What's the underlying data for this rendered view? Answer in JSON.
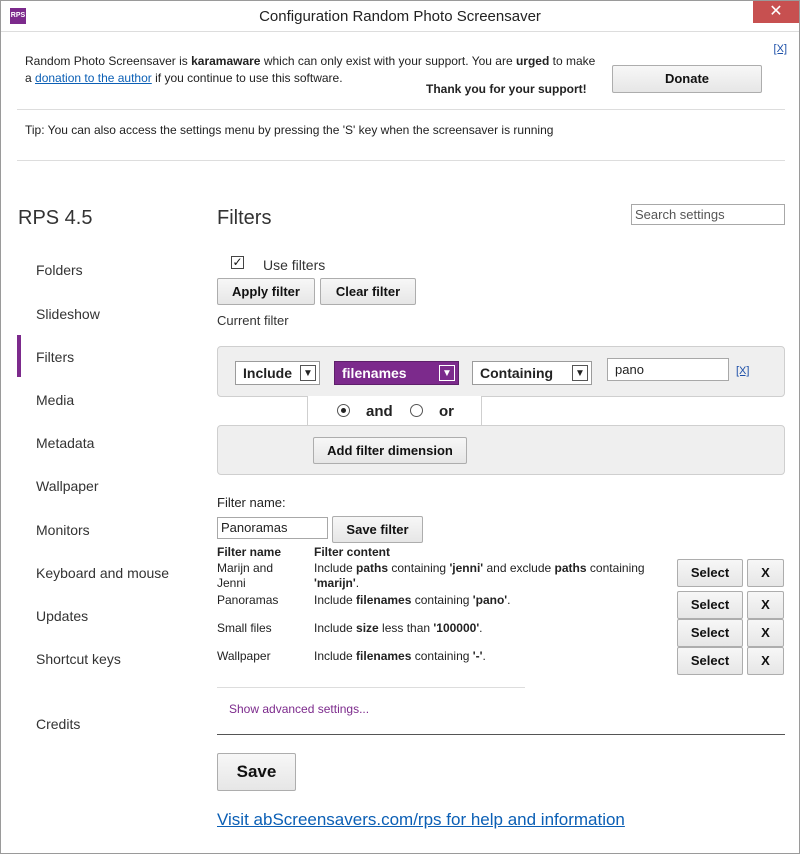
{
  "window": {
    "icon_text": "RPS",
    "title": "Configuration Random Photo Screensaver",
    "close_label": "✕"
  },
  "banner": {
    "line1_prefix": "Random Photo Screensaver is ",
    "line1_bold1": "karamaware",
    "line1_mid": " which can only exist with your support. You are ",
    "line1_bold2": "urged",
    "line1_suffix": " to make",
    "line2_prefix": "a ",
    "donation_link": "donation to the author",
    "line2_suffix": " if you continue to use this software.",
    "thanks": "Thank you for your support!",
    "donate_label": "Donate",
    "dismiss_label": "[X]"
  },
  "tip": "Tip: You can also access the settings menu by pressing the 'S' key when the screensaver is running",
  "sidebar": {
    "brand": "RPS 4.5",
    "items": [
      {
        "label": "Folders"
      },
      {
        "label": "Slideshow"
      },
      {
        "label": "Filters"
      },
      {
        "label": "Media"
      },
      {
        "label": "Metadata"
      },
      {
        "label": "Wallpaper"
      },
      {
        "label": "Monitors"
      },
      {
        "label": "Keyboard and mouse"
      },
      {
        "label": "Updates"
      },
      {
        "label": "Shortcut keys"
      },
      {
        "label": "Credits"
      }
    ],
    "active": "Filters"
  },
  "main": {
    "title": "Filters",
    "search_placeholder": "Search settings",
    "use_filters_label": "Use filters",
    "use_filters_checked": true,
    "apply_filter_label": "Apply filter",
    "clear_filter_label": "Clear filter",
    "current_filter_label": "Current filter",
    "filter_row": {
      "include": "Include",
      "field": "filenames",
      "operator": "Containing",
      "value": "pano",
      "remove_label": "[X]"
    },
    "and_label": "and",
    "or_label": "or",
    "combine_selected": "and",
    "add_dimension_label": "Add filter dimension",
    "filter_name_label": "Filter name:",
    "filter_name_value": "Panoramas",
    "save_filter_label": "Save filter",
    "table": {
      "headers": [
        "Filter name",
        "Filter content"
      ],
      "rows": [
        {
          "name": "Marijn and Jenni",
          "content": [
            {
              "t": "Include "
            },
            {
              "b": "paths"
            },
            {
              "t": " containing "
            },
            {
              "b": "'jenni'"
            },
            {
              "t": " and exclude "
            },
            {
              "b": "paths"
            },
            {
              "t": " containing "
            },
            {
              "b": "'marijn'"
            },
            {
              "t": "."
            }
          ]
        },
        {
          "name": "Panoramas",
          "content": [
            {
              "t": "Include "
            },
            {
              "b": "filenames"
            },
            {
              "t": " containing "
            },
            {
              "b": "'pano'"
            },
            {
              "t": "."
            }
          ]
        },
        {
          "name": "Small files",
          "content": [
            {
              "t": "Include "
            },
            {
              "b": "size"
            },
            {
              "t": " less than "
            },
            {
              "b": "'100000'"
            },
            {
              "t": "."
            }
          ]
        },
        {
          "name": "Wallpaper",
          "content": [
            {
              "t": "Include "
            },
            {
              "b": "filenames"
            },
            {
              "t": " containing "
            },
            {
              "b": "'-'"
            },
            {
              "t": "."
            }
          ]
        }
      ],
      "select_label": "Select",
      "delete_label": "X"
    },
    "show_advanced_label": "Show advanced settings...",
    "save_label": "Save",
    "footer_link": "Visit abScreensavers.com/rps for help and information"
  },
  "colors": {
    "accent": "#7c2a8c",
    "link": "#0b5fb5",
    "panel_bg": "#efefef"
  }
}
